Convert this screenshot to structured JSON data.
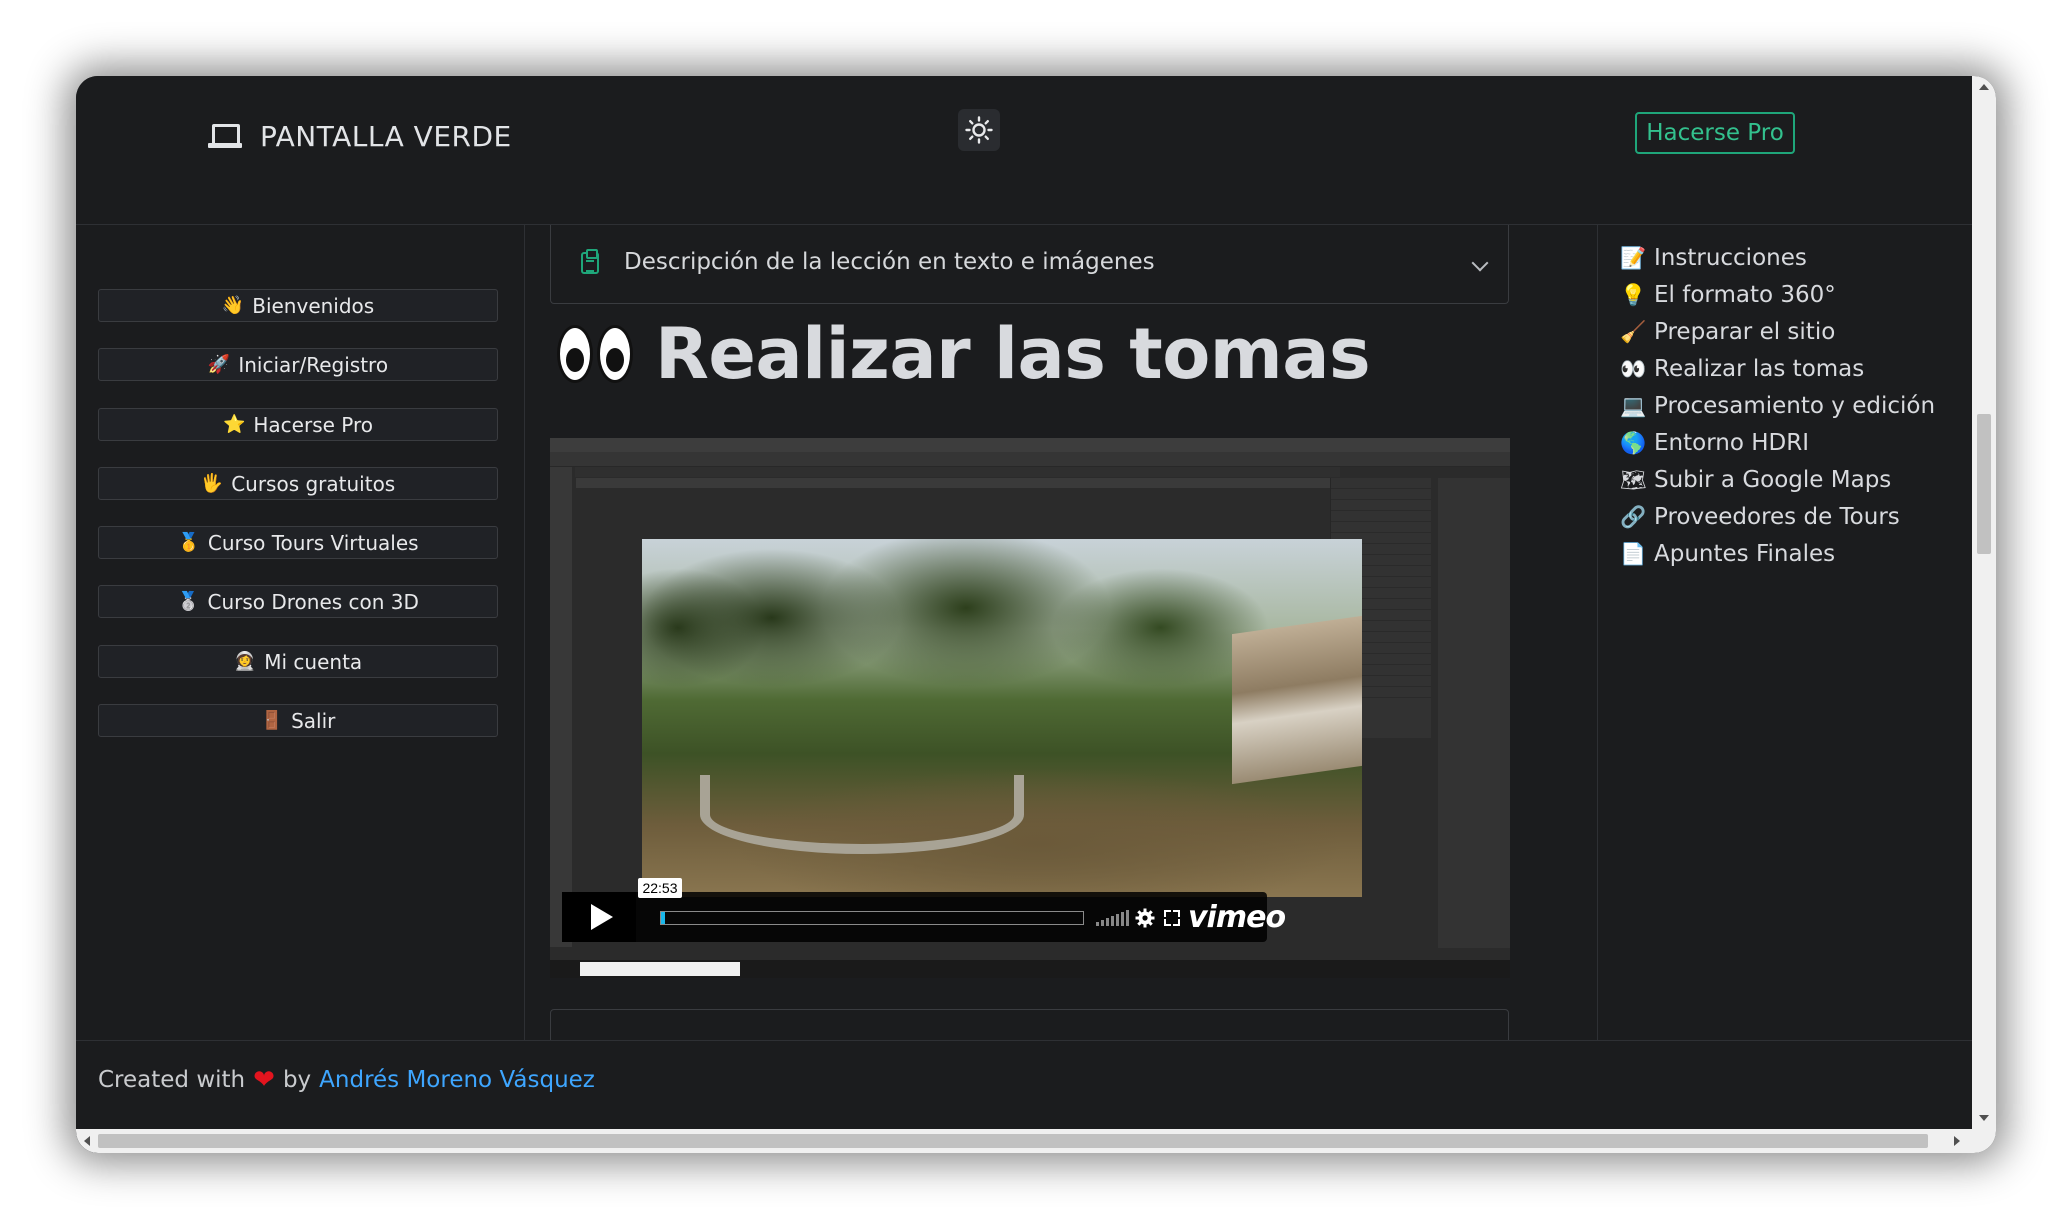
{
  "header": {
    "brand_icon": "laptop-icon",
    "brand_title": "PANTALLA VERDE",
    "theme_toggle_icon": "sun-icon",
    "go_pro_label": "Hacerse Pro",
    "accent_color": "#1fa67a"
  },
  "sidebar": {
    "items": [
      {
        "emoji": "👋",
        "label": "Bienvenidos"
      },
      {
        "emoji": "🚀",
        "label": "Iniciar/Registro"
      },
      {
        "emoji": "⭐",
        "label": "Hacerse Pro"
      },
      {
        "emoji": "🖐",
        "label": "Cursos gratuitos"
      },
      {
        "emoji": "🥇",
        "label": "Curso Tours Virtuales"
      },
      {
        "emoji": "🥈",
        "label": "Curso Drones con 3D"
      },
      {
        "emoji": "👩‍🚀",
        "label": "Mi cuenta"
      },
      {
        "emoji": "🚪",
        "label": "Salir"
      }
    ]
  },
  "main": {
    "accordion_title": "Descripción de la lección en texto e imágenes",
    "lesson_title": "Realizar las tomas",
    "lesson_icon": "eyes-icon",
    "video": {
      "timecode": "22:53",
      "progress": 0.01,
      "brand": "vimeo"
    }
  },
  "toc": {
    "items": [
      {
        "emoji": "📝",
        "label": "Instrucciones"
      },
      {
        "emoji": "💡",
        "label": "El formato 360°"
      },
      {
        "emoji": "🧹",
        "label": "Preparar el sitio"
      },
      {
        "emoji": "👀",
        "label": "Realizar las tomas"
      },
      {
        "emoji": "💻",
        "label": "Procesamiento y edición"
      },
      {
        "emoji": "🌎",
        "label": "Entorno HDRI"
      },
      {
        "emoji": "🗺",
        "label": "Subir a Google Maps"
      },
      {
        "emoji": "🔗",
        "label": "Proveedores de Tours"
      },
      {
        "emoji": "📄",
        "label": "Apuntes Finales"
      }
    ]
  },
  "footer": {
    "created_with": "Created with",
    "heart": "❤",
    "by": "by",
    "author": "Andrés Moreno Vásquez"
  }
}
